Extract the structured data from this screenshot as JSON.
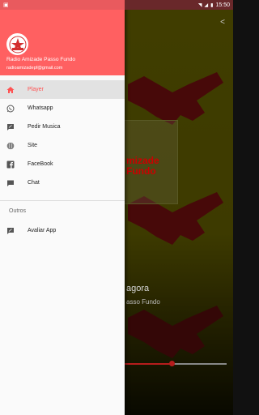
{
  "status_bar": {
    "time": "15:50"
  },
  "drawer": {
    "header": {
      "app_name": "Radio Amizade Passo Fundo",
      "email": "radioamizadepf@gmail.com",
      "logo_icon": "radio-logo-icon"
    },
    "items": [
      {
        "label": "Player",
        "icon": "home-icon",
        "active": true
      },
      {
        "label": "Whatsapp",
        "icon": "whatsapp-icon"
      },
      {
        "label": "Pedir Musica",
        "icon": "feedback-icon"
      },
      {
        "label": "Site",
        "icon": "globe-icon"
      },
      {
        "label": "FaceBook",
        "icon": "facebook-icon"
      },
      {
        "label": "Chat",
        "icon": "chat-icon"
      }
    ],
    "section_title": "Outros",
    "other_items": [
      {
        "label": "Avaliar App",
        "icon": "rate-icon"
      }
    ],
    "accent_color": "#ff6061",
    "active_color": "#ff5252"
  },
  "background_app": {
    "logo_text_line1": "mizade",
    "logo_text_line2": "Fundo",
    "now_playing_fragment": "agora",
    "station_fragment": "asso Fundo",
    "seek_progress": 0.46
  }
}
